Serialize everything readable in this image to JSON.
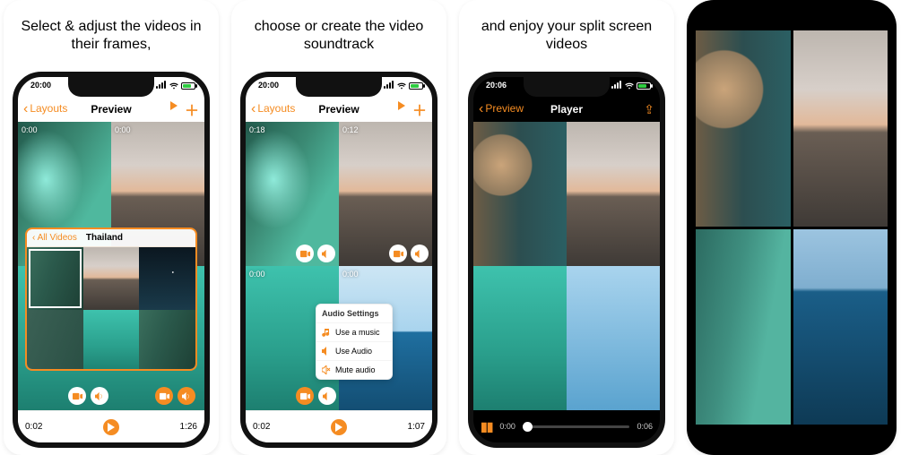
{
  "captions": {
    "c1": "Select & adjust the videos in their frames,",
    "c2": "choose or create the video soundtrack",
    "c3": "and enjoy your split screen videos"
  },
  "status": {
    "t1": "20:00",
    "t2": "20:00",
    "t3": "20:06"
  },
  "nav": {
    "back_layouts": "Layouts",
    "title_preview": "Preview",
    "back_preview": "Preview",
    "title_player": "Player"
  },
  "p1": {
    "tc": {
      "tl1": "0:00",
      "tl2": "0:00"
    },
    "bar": {
      "left": "0:02",
      "right": "1:26"
    },
    "picker": {
      "back": "All Videos",
      "title": "Thailand"
    }
  },
  "p2": {
    "tc": {
      "tl1": "0:18",
      "tl2": "0:12",
      "tl3": "0:00",
      "tl4": "0:00"
    },
    "bar": {
      "left": "0:02",
      "right": "1:07"
    },
    "menu": {
      "title": "Audio Settings",
      "m1": "Use a music",
      "m2": "Use Audio",
      "m3": "Mute audio"
    }
  },
  "p3": {
    "slider": {
      "left": "0:00",
      "right": "0:06"
    }
  }
}
